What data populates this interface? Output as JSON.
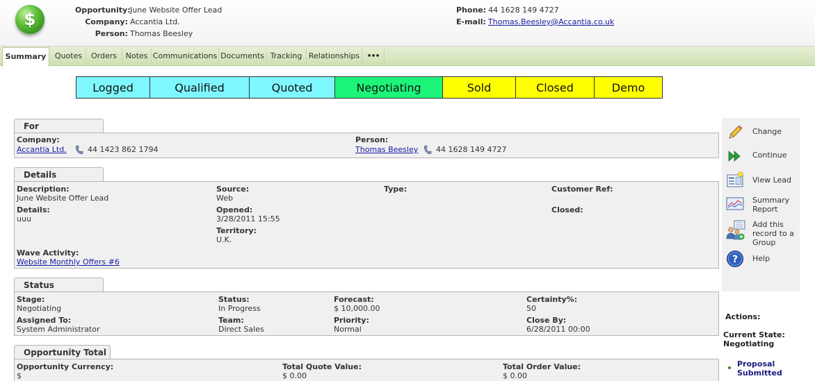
{
  "header": {
    "opportunity_label": "Opportunity:",
    "opportunity_value": "June Website Offer Lead",
    "company_label": "Company:",
    "company_value": "Accantia Ltd.",
    "person_label": "Person:",
    "person_value": "Thomas Beesley",
    "phone_label": "Phone:",
    "phone_value": "44 1628 149 4727",
    "email_label": "E-mail:",
    "email_value": "Thomas.Beesley@Accantia.co.uk",
    "logo_symbol": "$"
  },
  "tabs": [
    {
      "label": "Summary",
      "active": true
    },
    {
      "label": "Quotes"
    },
    {
      "label": "Orders"
    },
    {
      "label": "Notes"
    },
    {
      "label": "Communications"
    },
    {
      "label": "Documents"
    },
    {
      "label": "Tracking"
    },
    {
      "label": "Relationships"
    },
    {
      "label": "•••"
    }
  ],
  "stages": [
    {
      "label": "Logged",
      "color": "#7ff7ff"
    },
    {
      "label": "Qualified",
      "color": "#7ff7ff"
    },
    {
      "label": "Quoted",
      "color": "#7ff7ff"
    },
    {
      "label": "Negotiating",
      "color": "#1cf57a"
    },
    {
      "label": "Sold",
      "color": "#ffff00"
    },
    {
      "label": "Closed",
      "color": "#ffff00"
    },
    {
      "label": "Demo",
      "color": "#ffff00"
    }
  ],
  "for_panel": {
    "title": "For",
    "company_label": "Company:",
    "company_value": "Accantia Ltd.",
    "company_phone": "44 1423 862 1794",
    "person_label": "Person:",
    "person_value": "Thomas Beesley",
    "person_phone": "44 1628 149 4727"
  },
  "details_panel": {
    "title": "Details",
    "description_label": "Description:",
    "description_value": "June Website Offer Lead",
    "details_label": "Details:",
    "details_value": "uuu",
    "wave_label": "Wave Activity:",
    "wave_value": "Website Monthly Offers #6",
    "source_label": "Source:",
    "source_value": "Web",
    "opened_label": "Opened:",
    "opened_value": "3/28/2011 15:55",
    "territory_label": "Territory:",
    "territory_value": "U.K.",
    "type_label": "Type:",
    "customer_ref_label": "Customer Ref:",
    "closed_label": "Closed:"
  },
  "status_panel": {
    "title": "Status",
    "stage_label": "Stage:",
    "stage_value": "Negotiating",
    "assigned_label": "Assigned To:",
    "assigned_value": "System Administrator",
    "status_label": "Status:",
    "status_value": "In Progress",
    "team_label": "Team:",
    "team_value": "Direct Sales",
    "forecast_label": "Forecast:",
    "forecast_value": "$ 10,000.00",
    "priority_label": "Priority:",
    "priority_value": "Normal",
    "certainty_label": "Certainty%:",
    "certainty_value": "50",
    "closeby_label": "Close By:",
    "closeby_value": "6/28/2011 00:00"
  },
  "total_panel": {
    "title": "Opportunity Total",
    "currency_label": "Opportunity Currency:",
    "currency_value": "$",
    "quote_label": "Total Quote Value:",
    "quote_value": "$ 0.00",
    "order_label": "Total Order Value:",
    "order_value": "$ 0.00"
  },
  "actions": {
    "change": "Change",
    "continue": "Continue",
    "view_lead": "View Lead",
    "summary_report_1": "Summary",
    "summary_report_2": "Report",
    "add_group_1": "Add this",
    "add_group_2": "record to a",
    "add_group_3": "Group",
    "help": "Help",
    "actions_label": "Actions:",
    "current_state_label": "Current State:",
    "current_state_value": "Negotiating",
    "proposal_1": "Proposal",
    "proposal_2": "Submitted"
  }
}
